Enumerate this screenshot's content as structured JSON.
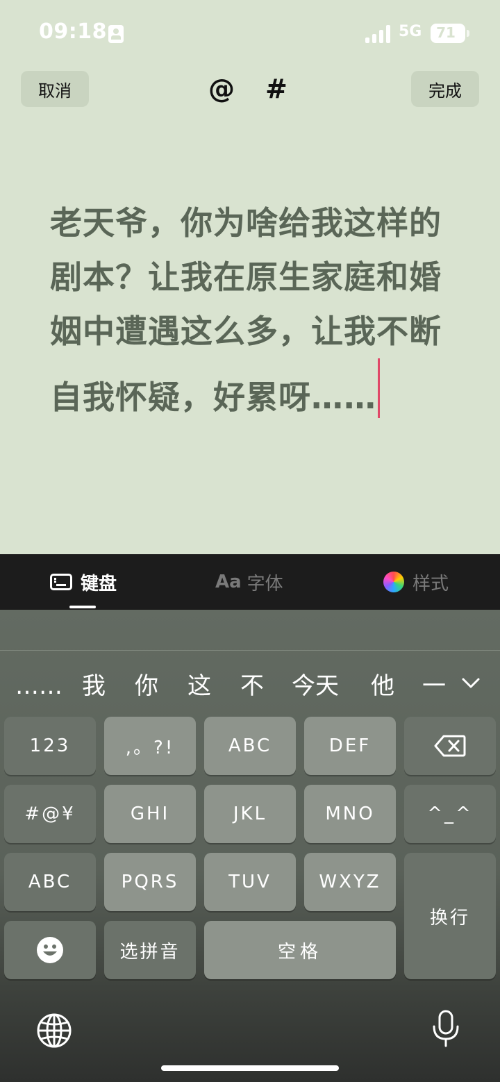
{
  "status": {
    "time": "09:18",
    "network": "5G",
    "battery": "71",
    "battery_level": 0.71
  },
  "toolbar": {
    "cancel_label": "取消",
    "done_label": "完成",
    "mention_symbol": "@",
    "hashtag_symbol": "#"
  },
  "editor": {
    "text": "老天爷，你为啥给我这样的剧本？让我在原生家庭和婚姻中遭遇这么多，让我不断自我怀疑，好累呀……"
  },
  "format_tabs": [
    {
      "label": "键盘",
      "icon": "keyboard-icon",
      "active": true
    },
    {
      "label": "字体",
      "icon_text": "Aa",
      "active": false
    },
    {
      "label": "样式",
      "icon": "color-wheel-icon",
      "active": false
    }
  ],
  "candidates": [
    "……",
    "我",
    "你",
    "这",
    "不",
    "今天",
    "他",
    "一"
  ],
  "keys": {
    "num": "123",
    "punct": ",。?!",
    "abc1": "ABC",
    "def": "DEF",
    "sym": "#@¥",
    "ghi": "GHI",
    "jkl": "JKL",
    "mno": "MNO",
    "emoticon": "^_^",
    "abc_switch": "ABC",
    "pqrs": "PQRS",
    "tuv": "TUV",
    "wxyz": "WXYZ",
    "newline": "换行",
    "pinyin": "选拼音",
    "space": "空格"
  },
  "colors": {
    "background": "#d9e3d0",
    "text": "#5a6657",
    "cursor": "#e04868",
    "keyboard": "#5a6159"
  }
}
